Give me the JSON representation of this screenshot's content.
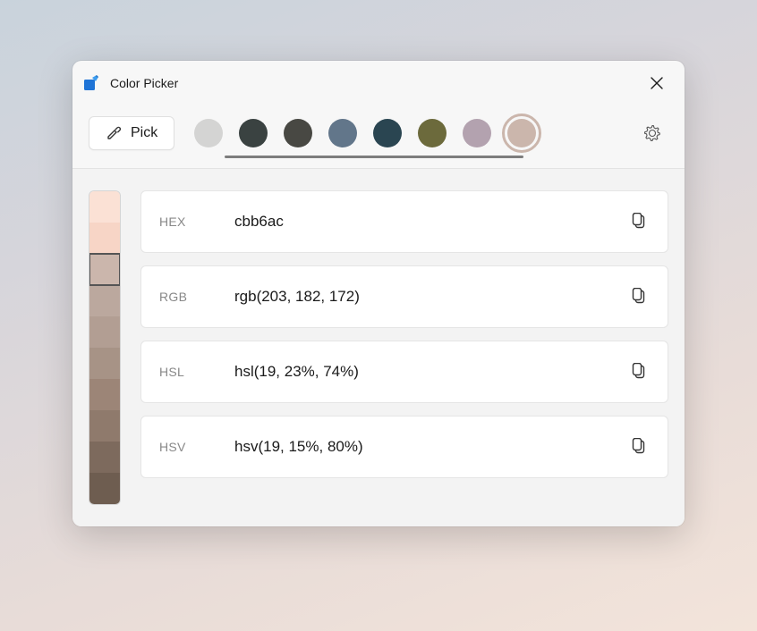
{
  "window": {
    "title": "Color Picker"
  },
  "toolbar": {
    "pick_label": "Pick",
    "swatches": [
      {
        "color": "#d4d4d3",
        "selected": false
      },
      {
        "color": "#3a4241",
        "selected": false
      },
      {
        "color": "#484843",
        "selected": false
      },
      {
        "color": "#62768a",
        "selected": false
      },
      {
        "color": "#2a4551",
        "selected": false
      },
      {
        "color": "#6c6a3c",
        "selected": false
      },
      {
        "color": "#b3a2af",
        "selected": false
      },
      {
        "color": "#cbb6ac",
        "selected": true
      }
    ]
  },
  "shades": [
    {
      "color": "#fbe1d5",
      "current": false
    },
    {
      "color": "#f7d5c6",
      "current": false
    },
    {
      "color": "#cbb6ac",
      "current": true
    },
    {
      "color": "#bba89e",
      "current": false
    },
    {
      "color": "#b29e93",
      "current": false
    },
    {
      "color": "#a79386",
      "current": false
    },
    {
      "color": "#9c8577",
      "current": false
    },
    {
      "color": "#8f7a6c",
      "current": false
    },
    {
      "color": "#7d6a5d",
      "current": false
    },
    {
      "color": "#6e5d50",
      "current": false
    }
  ],
  "formats": [
    {
      "label": "HEX",
      "value": "cbb6ac"
    },
    {
      "label": "RGB",
      "value": "rgb(203, 182, 172)"
    },
    {
      "label": "HSL",
      "value": "hsl(19, 23%, 74%)"
    },
    {
      "label": "HSV",
      "value": "hsv(19, 15%, 80%)"
    }
  ]
}
